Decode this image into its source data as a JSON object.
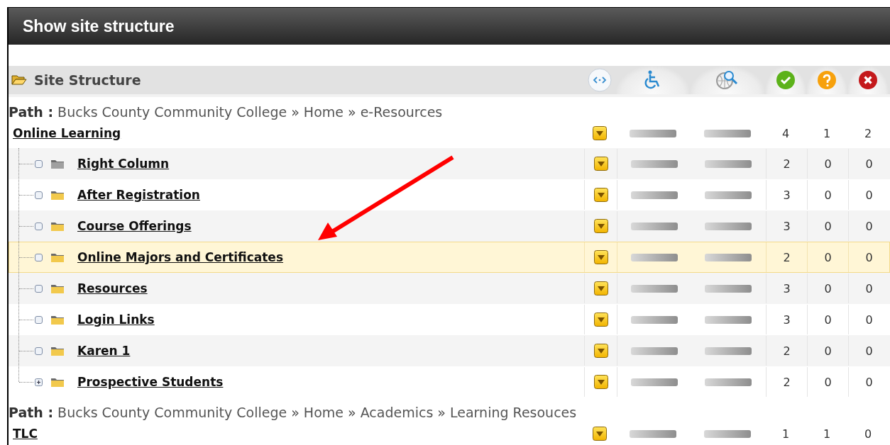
{
  "window": {
    "title": "Show site structure"
  },
  "panel": {
    "title": "Site Structure"
  },
  "sections": [
    {
      "path_label": "Path :",
      "path": "Bucks County Community College » Home » e-Resources",
      "root": {
        "label": "Online Learning",
        "counts": [
          "4",
          "1",
          "2"
        ]
      },
      "children": [
        {
          "label": "Right Column",
          "color": "#a0a0a0",
          "expandable": false,
          "selected": false,
          "counts": [
            "2",
            "0",
            "0"
          ]
        },
        {
          "label": "After Registration",
          "color": "#f2c94c",
          "expandable": false,
          "selected": false,
          "counts": [
            "3",
            "0",
            "0"
          ]
        },
        {
          "label": "Course Offerings",
          "color": "#f2c94c",
          "expandable": false,
          "selected": false,
          "counts": [
            "3",
            "0",
            "0"
          ]
        },
        {
          "label": "Online Majors and Certificates",
          "color": "#f2c94c",
          "expandable": false,
          "selected": true,
          "counts": [
            "2",
            "0",
            "0"
          ]
        },
        {
          "label": "Resources",
          "color": "#f2c94c",
          "expandable": false,
          "selected": false,
          "counts": [
            "3",
            "0",
            "0"
          ]
        },
        {
          "label": "Login Links",
          "color": "#f2c94c",
          "expandable": false,
          "selected": false,
          "counts": [
            "3",
            "0",
            "0"
          ]
        },
        {
          "label": "Karen 1",
          "color": "#f2c94c",
          "expandable": false,
          "selected": false,
          "counts": [
            "2",
            "0",
            "0"
          ]
        },
        {
          "label": "Prospective Students",
          "color": "#f2c94c",
          "expandable": true,
          "selected": false,
          "counts": [
            "2",
            "0",
            "0"
          ]
        }
      ]
    },
    {
      "path_label": "Path :",
      "path": "Bucks County Community College » Home » Academics » Learning Resouces",
      "root": {
        "label": "TLC",
        "counts": [
          "1",
          "1",
          "0"
        ]
      }
    }
  ]
}
